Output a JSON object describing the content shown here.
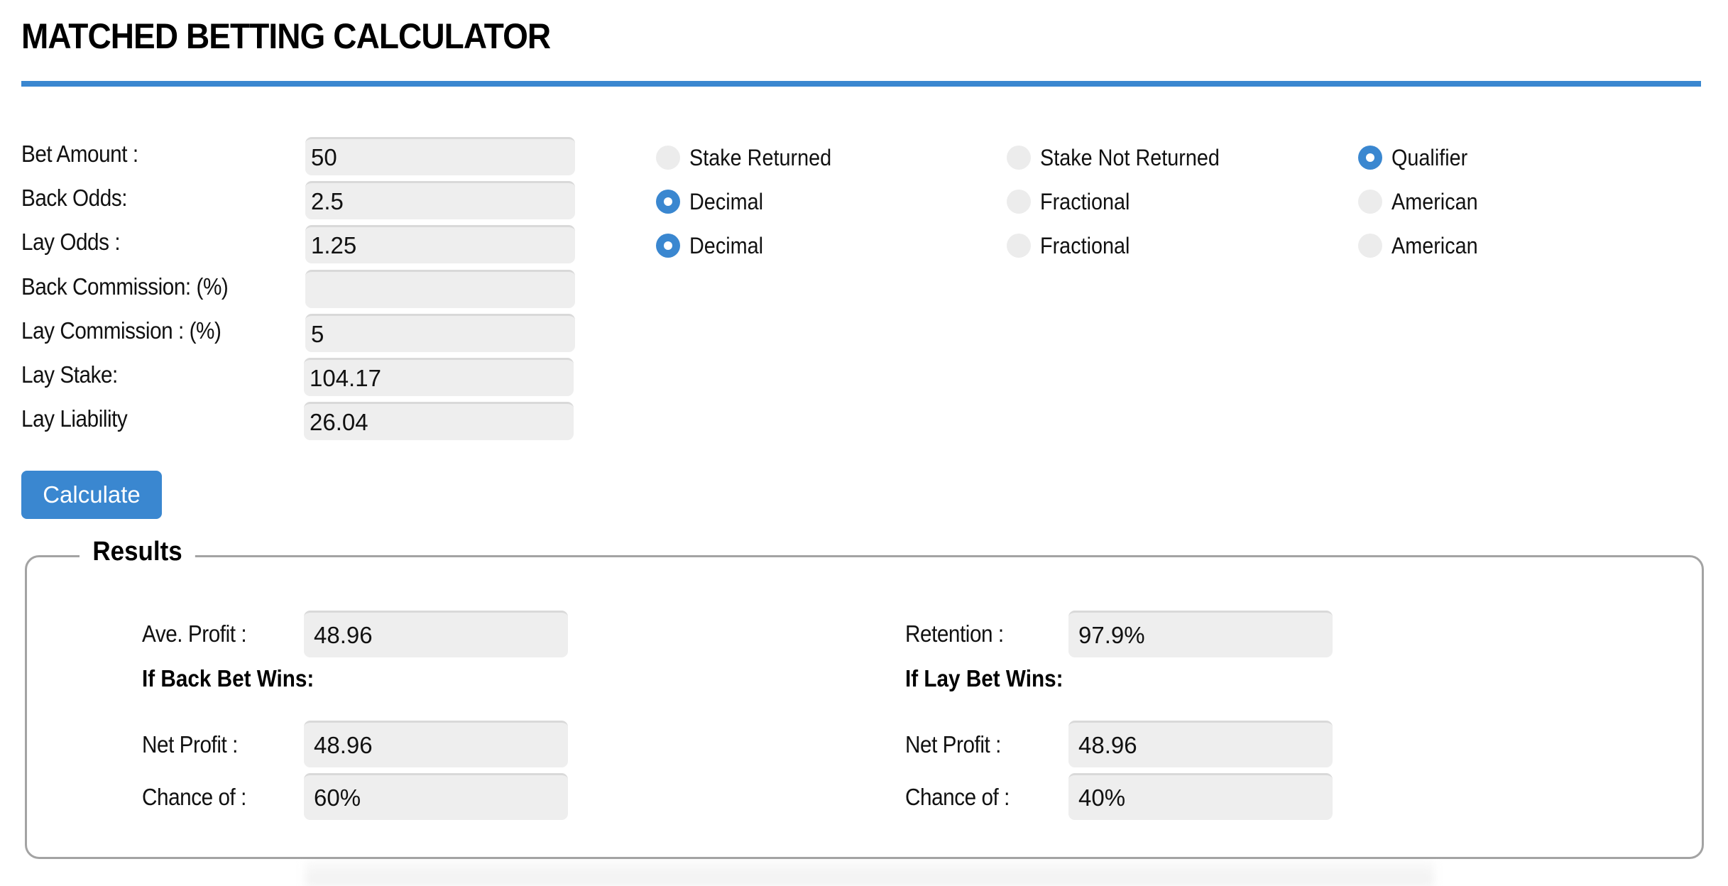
{
  "header": {
    "title": "MATCHED BETTING CALCULATOR",
    "accent_color": "#3a87d0"
  },
  "form": {
    "fields": [
      {
        "label": "Bet Amount :",
        "value": "50"
      },
      {
        "label": "Back Odds:",
        "value": "2.5"
      },
      {
        "label": "Lay Odds :",
        "value": "1.25"
      },
      {
        "label": "Back Commission: (%)",
        "value": ""
      },
      {
        "label": "Lay Commission : (%)",
        "value": "5"
      },
      {
        "label": "Lay Stake:",
        "value": "104.17"
      },
      {
        "label": "Lay Liability",
        "value": "26.04"
      }
    ],
    "radio_groups": [
      {
        "name": "bet-type",
        "options": [
          {
            "label": "Stake Returned",
            "checked": false
          },
          {
            "label": "Stake Not Returned",
            "checked": false
          },
          {
            "label": "Qualifier",
            "checked": true
          }
        ]
      },
      {
        "name": "back-odds-format",
        "options": [
          {
            "label": "Decimal",
            "checked": true
          },
          {
            "label": "Fractional",
            "checked": false
          },
          {
            "label": "American",
            "checked": false
          }
        ]
      },
      {
        "name": "lay-odds-format",
        "options": [
          {
            "label": "Decimal",
            "checked": true
          },
          {
            "label": "Fractional",
            "checked": false
          },
          {
            "label": "American",
            "checked": false
          }
        ]
      }
    ],
    "calculate_label": "Calculate"
  },
  "results": {
    "legend": "Results",
    "left": {
      "summary_label": "Ave. Profit :",
      "summary_value": "48.96",
      "heading": "If Back Bet Wins:",
      "net_profit_label": "Net Profit :",
      "net_profit_value": "48.96",
      "chance_label": "Chance of :",
      "chance_value": "60%"
    },
    "right": {
      "summary_label": "Retention :",
      "summary_value": "97.9%",
      "heading": "If Lay Bet Wins:",
      "net_profit_label": "Net Profit :",
      "net_profit_value": "48.96",
      "chance_label": "Chance of :",
      "chance_value": "40%"
    }
  }
}
